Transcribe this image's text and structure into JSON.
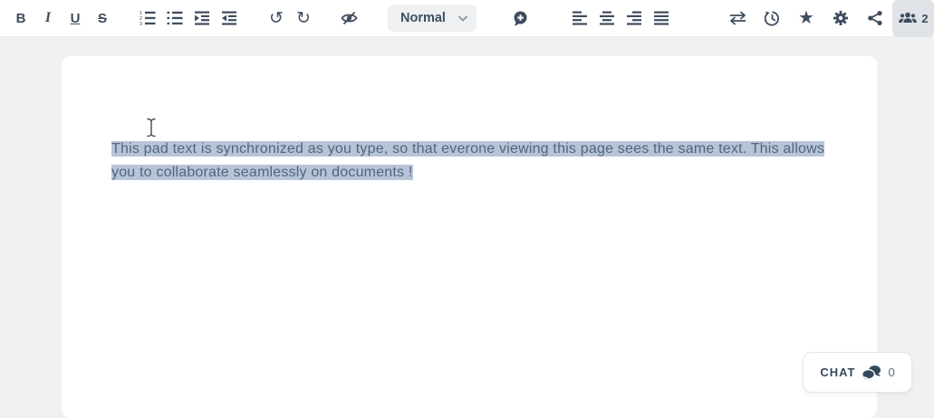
{
  "toolbar": {
    "format": {
      "bold": "B",
      "italic": "I",
      "underline": "U",
      "strike": "S"
    },
    "glyphs": {
      "undo": "↺",
      "redo": "↻",
      "star": "★"
    },
    "style_dropdown": {
      "value": "Normal"
    },
    "users": {
      "count": "2"
    }
  },
  "editor": {
    "text": "This pad text is synchronized as you type, so that everone viewing this page sees the same text. This allows you to collaborate seamlessly on documents !"
  },
  "chat": {
    "label": "CHAT",
    "count": "0"
  },
  "colors": {
    "icon": "#3e4d5e",
    "selection_bg": "#b7c4d8",
    "selection_text": "#54647e",
    "page_bg": "#eff1f2",
    "toolbar_bg": "#ffffff",
    "users_button_bg": "#dfe3e7"
  }
}
